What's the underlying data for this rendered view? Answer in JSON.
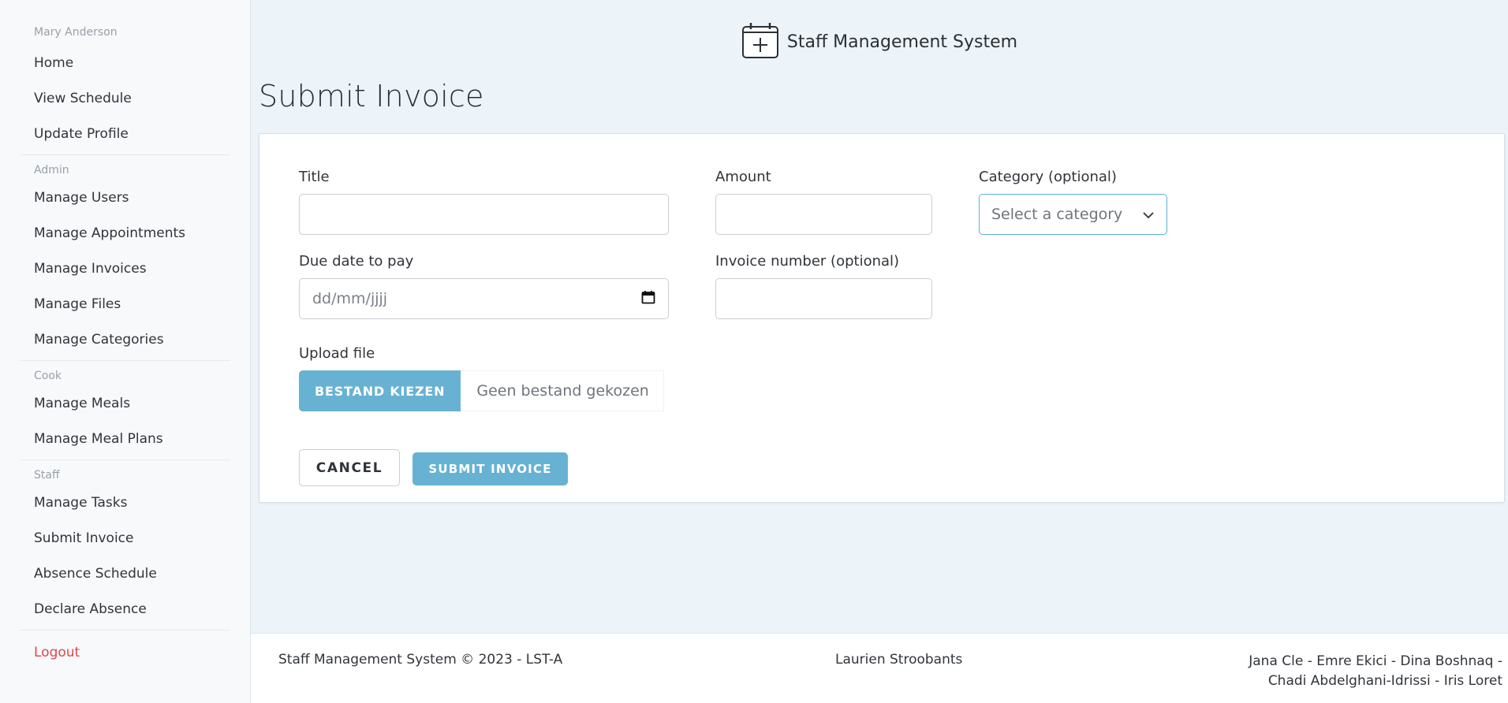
{
  "sidebar": {
    "user_name": "Mary Anderson",
    "user_items": [
      "Home",
      "View Schedule",
      "Update Profile"
    ],
    "admin_label": "Admin",
    "admin_items": [
      "Manage Users",
      "Manage Appointments",
      "Manage Invoices",
      "Manage Files",
      "Manage Categories"
    ],
    "cook_label": "Cook",
    "cook_items": [
      "Manage Meals",
      "Manage Meal Plans"
    ],
    "staff_label": "Staff",
    "staff_items": [
      "Manage Tasks",
      "Submit Invoice",
      "Absence Schedule",
      "Declare Absence"
    ],
    "logout": "Logout"
  },
  "header": {
    "app_title": "Staff Management System",
    "logo_icon": "calendar-plus-icon"
  },
  "page": {
    "title": "Submit Invoice"
  },
  "form": {
    "title_label": "Title",
    "title_value": "",
    "amount_label": "Amount",
    "amount_value": "",
    "category_label": "Category (optional)",
    "category_selected": "Select a category",
    "due_date_label": "Due date to pay",
    "due_date_placeholder": "dd/mm/jjjj",
    "invoice_number_label": "Invoice number (optional)",
    "invoice_number_value": "",
    "upload_label": "Upload file",
    "file_button": "BESTAND KIEZEN",
    "file_status": "Geen bestand gekozen",
    "cancel_button": "CANCEL",
    "submit_button": "SUBMIT INVOICE"
  },
  "footer": {
    "copyright": "Staff Management System © 2023 - LST-A",
    "center_name": "Laurien Stroobants",
    "team_line1": "Jana Cle - Emre Ekici - Dina Boshnaq -",
    "team_line2": "Chadi Abdelghani-Idrissi - Iris Loret"
  },
  "colors": {
    "accent": "#67b2d3",
    "logout": "#e0454f",
    "background": "#ecf4fa"
  }
}
